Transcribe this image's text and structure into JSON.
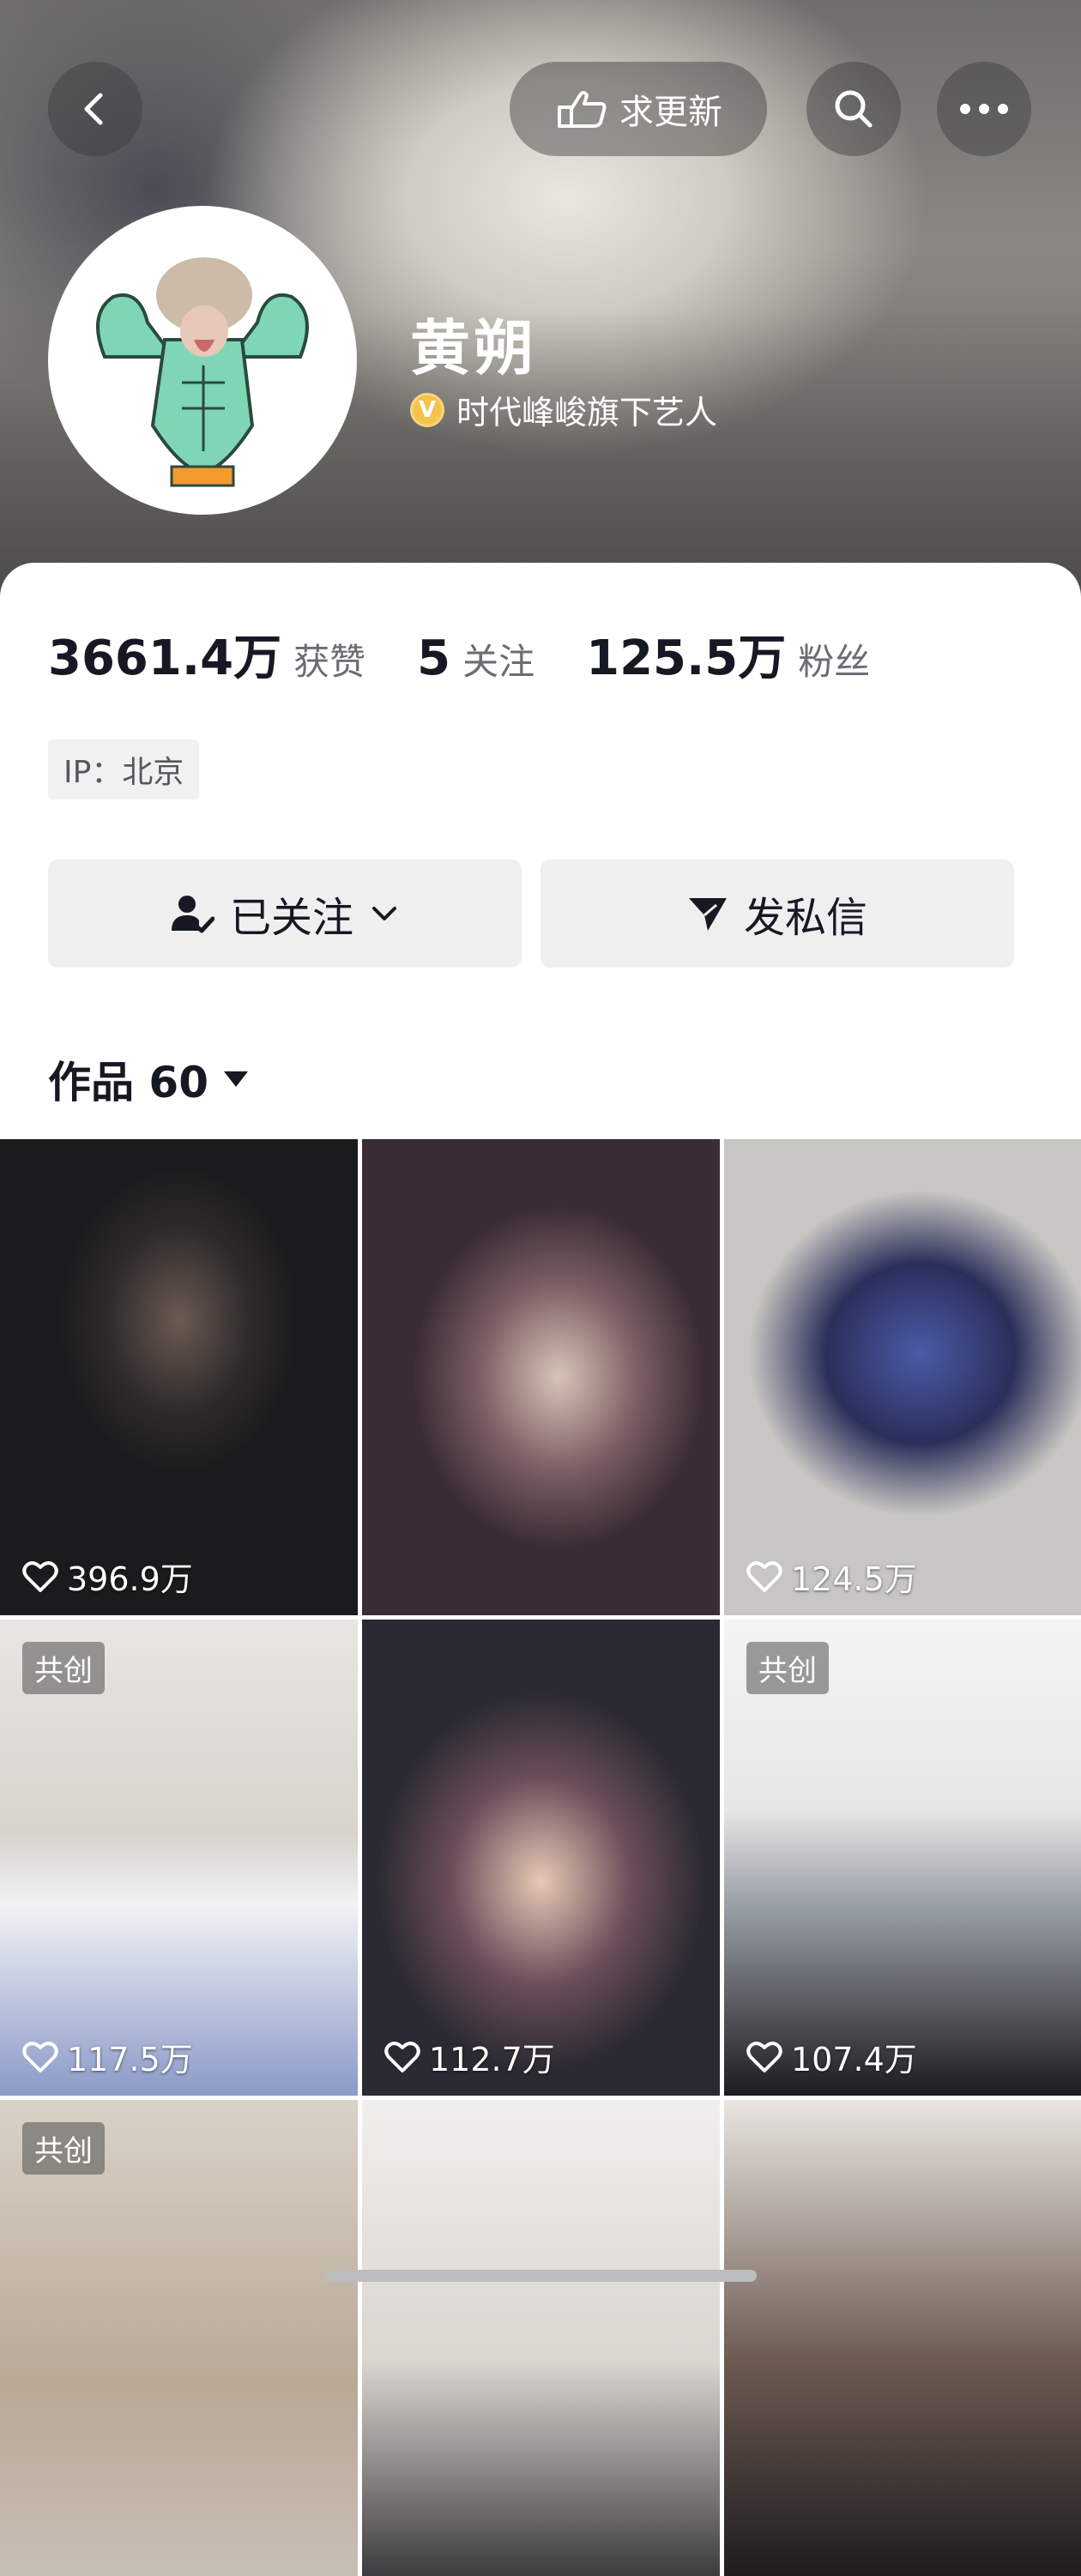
{
  "header": {
    "update_label": "求更新",
    "name": "黄朔",
    "verified_badge": "V",
    "verified_text": "时代峰峻旗下艺人"
  },
  "stats": [
    {
      "value": "3661.4万",
      "label": "获赞"
    },
    {
      "value": "5",
      "label": "关注"
    },
    {
      "value": "125.5万",
      "label": "粉丝"
    }
  ],
  "ip_tag": "IP：北京",
  "actions": {
    "follow_label": "已关注",
    "message_label": "发私信"
  },
  "works": {
    "title": "作品 60"
  },
  "grid": [
    {
      "likes": "396.9万",
      "badge": ""
    },
    {
      "likes": "",
      "badge": ""
    },
    {
      "likes": "124.5万",
      "badge": ""
    },
    {
      "likes": "117.5万",
      "badge": "共创"
    },
    {
      "likes": "112.7万",
      "badge": ""
    },
    {
      "likes": "107.4万",
      "badge": "共创"
    },
    {
      "likes": "",
      "badge": "共创"
    },
    {
      "likes": "",
      "badge": ""
    },
    {
      "likes": "",
      "badge": ""
    }
  ],
  "icons": {
    "back": "back-arrow-icon",
    "update": "pointing-hand-icon",
    "search": "search-icon",
    "more": "more-dots-icon",
    "follow": "user-check-icon",
    "message": "send-icon",
    "dropdown": "caret-down-icon",
    "like": "heart-outline-icon"
  },
  "colors": {
    "text_primary": "#161823",
    "text_secondary": "#6b6d74",
    "button_bg": "#efeff0",
    "verified_gold": "#f3c34c"
  }
}
